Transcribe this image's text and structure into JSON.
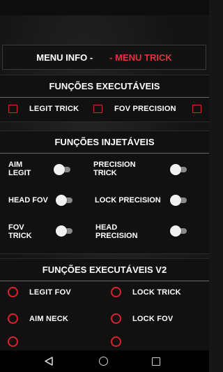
{
  "header": {
    "menu_info": "MENU INFO  -",
    "menu_trick": "- MENU TRICK"
  },
  "executaveis": {
    "title": "FUNÇÕES EXECUTÁVEIS",
    "items": [
      "LEGIT TRICK",
      "FOV PRECISION"
    ]
  },
  "injetaveis": {
    "title": "FUNÇÕES INJETÁVEIS",
    "toggles": [
      {
        "line1": "AIM",
        "line2": "LEGIT"
      },
      {
        "line1": "PRECISION",
        "line2": "TRICK"
      },
      {
        "line1": "HEAD FOV",
        "line2": ""
      },
      {
        "line1": "LOCK PRECISION",
        "line2": ""
      },
      {
        "line1": "FOV",
        "line2": "TRICK"
      },
      {
        "line1": "HEAD",
        "line2": "PRECISION"
      }
    ]
  },
  "executaveis_v2": {
    "title": "FUNÇÕES EXECUTÁVEIS V2",
    "items": [
      "LEGIT FOV",
      "LOCK TRICK",
      "AIM NECK",
      "LOCK FOV"
    ]
  },
  "colors": {
    "accent": "#d9232d",
    "background": "#141414"
  }
}
